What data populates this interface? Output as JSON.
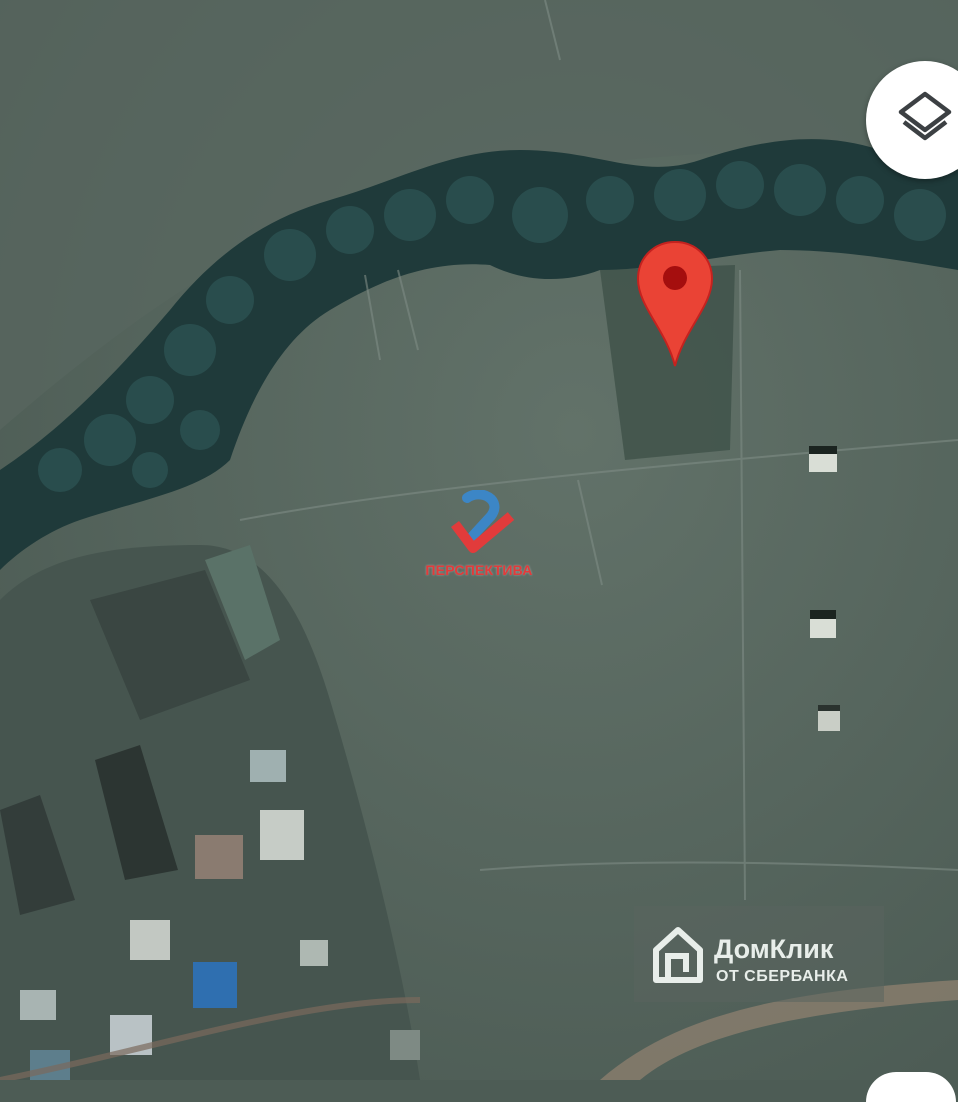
{
  "map": {
    "view": "satellite",
    "layers_button": {
      "icon": "layers-icon"
    },
    "marker": {
      "icon": "map-pin-icon",
      "color": "#ea4335"
    }
  },
  "watermarks": {
    "agency": {
      "text": "ПЕРСПЕКТИВА",
      "icon": "perspektiva-logo",
      "color": "#e23b3b"
    },
    "domclick": {
      "title": "ДомКлик",
      "subtitle": "ОТ СБЕРБАНКА",
      "icon": "domclick-house-logo"
    }
  },
  "colors": {
    "field": "#56665e",
    "trees": "#1f3a3a",
    "marker": "#ea4335"
  }
}
